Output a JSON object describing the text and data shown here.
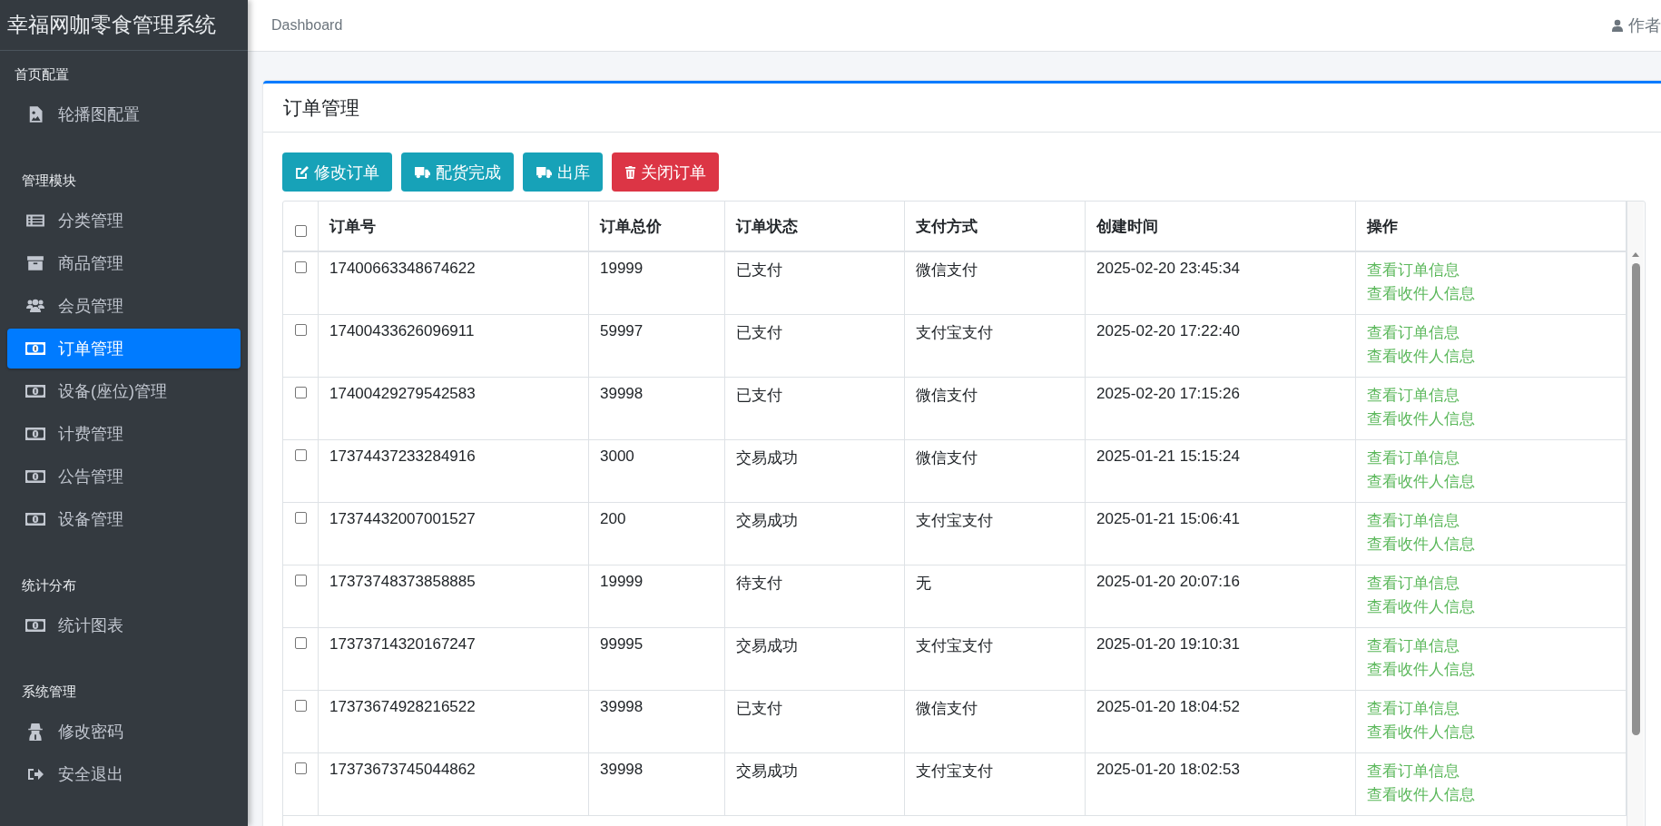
{
  "sidebar": {
    "title": "幸福网咖零食管理系统",
    "sections": [
      {
        "heading": "首页配置",
        "items": [
          {
            "label": "轮播图配置",
            "selected": false
          }
        ]
      },
      {
        "heading": "管理模块",
        "items": [
          {
            "label": "分类管理",
            "selected": false
          },
          {
            "label": "商品管理",
            "selected": false
          },
          {
            "label": "会员管理",
            "selected": false
          },
          {
            "label": "订单管理",
            "selected": true
          },
          {
            "label": "设备(座位)管理",
            "selected": false
          },
          {
            "label": "计费管理",
            "selected": false
          },
          {
            "label": "公告管理",
            "selected": false
          },
          {
            "label": "设备管理",
            "selected": false
          }
        ]
      },
      {
        "heading": "统计分布",
        "items": [
          {
            "label": "统计图表",
            "selected": false
          }
        ]
      },
      {
        "heading": "系统管理",
        "items": [
          {
            "label": "修改密码",
            "selected": false
          },
          {
            "label": "安全退出",
            "selected": false
          }
        ]
      }
    ]
  },
  "topbar": {
    "breadcrumb": "Dashboard",
    "user": "作者"
  },
  "card": {
    "title": "订单管理",
    "buttons": [
      {
        "label": "修改订单",
        "kind": "edit"
      },
      {
        "label": "配货完成",
        "kind": "truck"
      },
      {
        "label": "出库",
        "kind": "truck"
      },
      {
        "label": "关闭订单",
        "kind": "delete"
      }
    ],
    "table": {
      "select_all": false,
      "columns": [
        "订单号",
        "订单总价",
        "订单状态",
        "支付方式",
        "创建时间",
        "操作"
      ],
      "rows": [
        {
          "checked": false,
          "cells": [
            "17400663348674622",
            "19999",
            "已支付",
            "微信支付",
            "2025-02-20 23:45:34"
          ],
          "links": [
            "查看订单信息",
            "查看收件人信息"
          ]
        },
        {
          "checked": false,
          "cells": [
            "17400433626096911",
            "59997",
            "已支付",
            "支付宝支付",
            "2025-02-20 17:22:40"
          ],
          "links": [
            "查看订单信息",
            "查看收件人信息"
          ]
        },
        {
          "checked": false,
          "cells": [
            "17400429279542583",
            "39998",
            "已支付",
            "微信支付",
            "2025-02-20 17:15:26"
          ],
          "links": [
            "查看订单信息",
            "查看收件人信息"
          ]
        },
        {
          "checked": false,
          "cells": [
            "17374437233284916",
            "3000",
            "交易成功",
            "微信支付",
            "2025-01-21 15:15:24"
          ],
          "links": [
            "查看订单信息",
            "查看收件人信息"
          ]
        },
        {
          "checked": false,
          "cells": [
            "17374432007001527",
            "200",
            "交易成功",
            "支付宝支付",
            "2025-01-21 15:06:41"
          ],
          "links": [
            "查看订单信息",
            "查看收件人信息"
          ]
        },
        {
          "checked": false,
          "cells": [
            "17373748373858885",
            "19999",
            "待支付",
            "无",
            "2025-01-20 20:07:16"
          ],
          "links": [
            "查看订单信息",
            "查看收件人信息"
          ]
        },
        {
          "checked": false,
          "cells": [
            "17373714320167247",
            "99995",
            "交易成功",
            "支付宝支付",
            "2025-01-20 19:10:31"
          ],
          "links": [
            "查看订单信息",
            "查看收件人信息"
          ]
        },
        {
          "checked": false,
          "cells": [
            "17373674928216522",
            "39998",
            "已支付",
            "微信支付",
            "2025-01-20 18:04:52"
          ],
          "links": [
            "查看订单信息",
            "查看收件人信息"
          ]
        },
        {
          "checked": false,
          "cells": [
            "17373673745044862",
            "39998",
            "交易成功",
            "支付宝支付",
            "2025-01-20 18:02:53"
          ],
          "links": [
            "查看订单信息",
            "查看收件人信息"
          ]
        }
      ]
    }
  }
}
